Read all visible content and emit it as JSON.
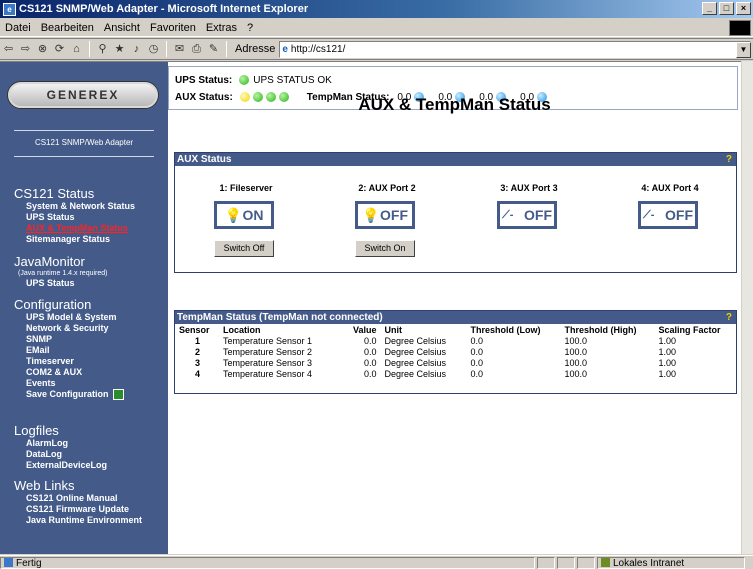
{
  "window": {
    "title": "CS121 SNMP/Web Adapter - Microsoft Internet Explorer",
    "minimize": "_",
    "maximize": "□",
    "close": "×"
  },
  "menu": [
    "Datei",
    "Bearbeiten",
    "Ansicht",
    "Favoriten",
    "Extras",
    "?"
  ],
  "address": {
    "label": "Adresse",
    "url": "http://cs121/"
  },
  "sidebar": {
    "logo": "GENEREX",
    "subtitle": "CS121 SNMP/Web Adapter",
    "sections": [
      {
        "heading": "CS121 Status",
        "items": [
          "System & Network Status",
          "UPS Status",
          "AUX & TempMan Status",
          "Sitemanager Status"
        ]
      },
      {
        "heading": "JavaMonitor",
        "note": "(Java runtime 1.4.x required)",
        "items": [
          "UPS Status"
        ]
      },
      {
        "heading": "Configuration",
        "items": [
          "UPS Model & System",
          "Network & Security",
          "SNMP",
          "EMail",
          "Timeserver",
          "COM2 & AUX",
          "Events",
          "Save Configuration"
        ]
      },
      {
        "heading": "Logfiles",
        "items": [
          "AlarmLog",
          "DataLog",
          "ExternalDeviceLog"
        ]
      },
      {
        "heading": "Web Links",
        "items": [
          "CS121 Online Manual",
          "CS121 Firmware Update",
          "Java Runtime Environment"
        ]
      }
    ]
  },
  "status": {
    "ups_label": "UPS Status:",
    "ups_text": "UPS STATUS OK",
    "aux_label": "AUX Status:",
    "tempman_label": "TempMan Status:",
    "temp_values": [
      "0.0",
      "0.0",
      "0.0",
      "0.0"
    ]
  },
  "page_title": "AUX & TempMan Status",
  "aux_panel": {
    "title": "AUX Status",
    "help": "?",
    "ports": [
      {
        "name": "1: Fileserver",
        "state": "ON",
        "button": "Switch Off"
      },
      {
        "name": "2: AUX Port 2",
        "state": "OFF",
        "button": "Switch On"
      },
      {
        "name": "3: AUX Port 3",
        "state": "OFF"
      },
      {
        "name": "4: AUX Port 4",
        "state": "OFF"
      }
    ]
  },
  "temp_panel": {
    "title": "TempMan Status  (TempMan not connected)",
    "help": "?",
    "columns": [
      "Sensor",
      "Location",
      "Value",
      "Unit",
      "Threshold (Low)",
      "Threshold (High)",
      "Scaling Factor"
    ],
    "rows": [
      [
        "1",
        "Temperature Sensor 1",
        "0.0",
        "Degree Celsius",
        "0.0",
        "100.0",
        "1.00"
      ],
      [
        "2",
        "Temperature Sensor 2",
        "0.0",
        "Degree Celsius",
        "0.0",
        "100.0",
        "1.00"
      ],
      [
        "3",
        "Temperature Sensor 3",
        "0.0",
        "Degree Celsius",
        "0.0",
        "100.0",
        "1.00"
      ],
      [
        "4",
        "Temperature Sensor 4",
        "0.0",
        "Degree Celsius",
        "0.0",
        "100.0",
        "1.00"
      ]
    ]
  },
  "statusbar": {
    "left": "Fertig",
    "zone": "Lokales Intranet"
  }
}
